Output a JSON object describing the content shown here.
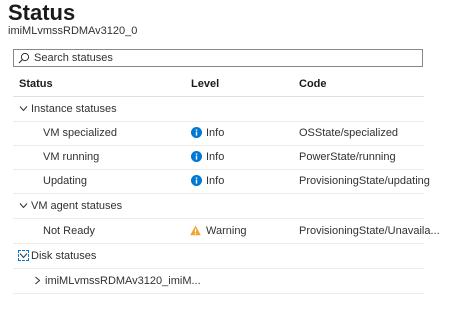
{
  "header": {
    "title": "Status",
    "subtitle": "imiMLvmssRDMAv3120_0"
  },
  "search": {
    "placeholder": "Search statuses"
  },
  "table": {
    "columns": [
      "Status",
      "Level",
      "Code"
    ],
    "groups": [
      {
        "label": "Instance statuses",
        "expanded": true,
        "rows": [
          {
            "status": "VM specialized",
            "level": "Info",
            "code": "OSState/specialized"
          },
          {
            "status": "VM running",
            "level": "Info",
            "code": "PowerState/running"
          },
          {
            "status": "Updating",
            "level": "Info",
            "code": "ProvisioningState/updating"
          }
        ]
      },
      {
        "label": "VM agent statuses",
        "expanded": true,
        "rows": [
          {
            "status": "Not Ready",
            "level": "Warning",
            "code": "ProvisioningState/Unavaila..."
          }
        ]
      },
      {
        "label": "Disk statuses",
        "expanded": true,
        "rows": [
          {
            "status": "imiMLvmssRDMAv3120_imiM...",
            "collapsed": true
          }
        ]
      }
    ]
  },
  "colors": {
    "info": "#0078d4",
    "warning": "#f2a42a",
    "border": "#e1dfdd",
    "focus": "#0078d4"
  }
}
